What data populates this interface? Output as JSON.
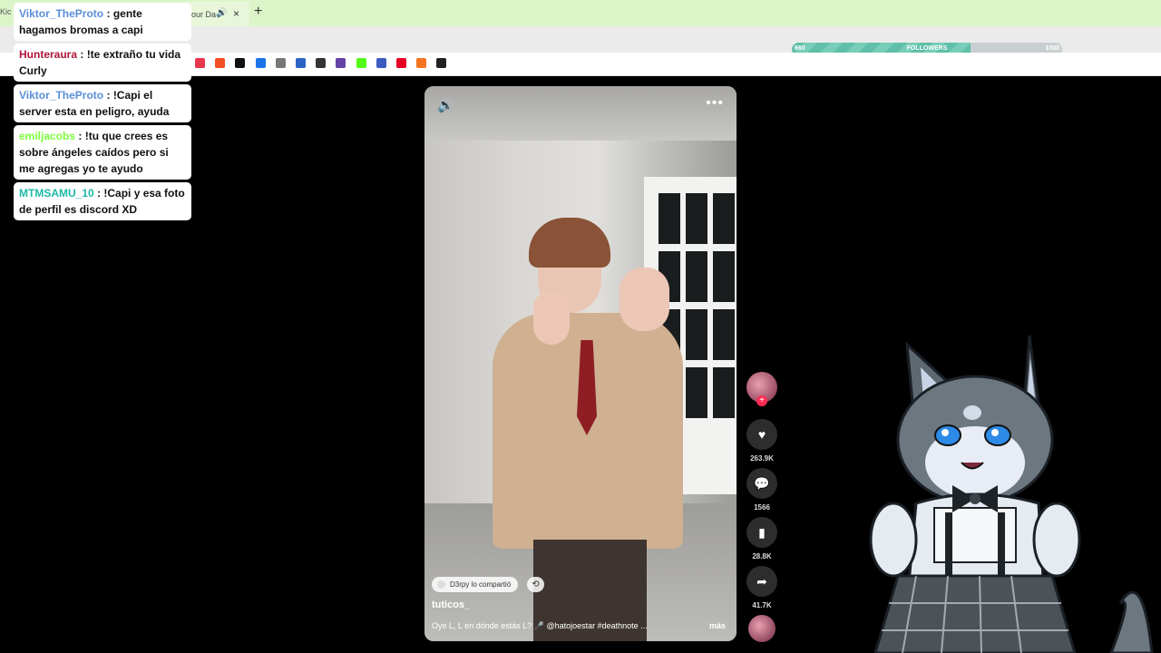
{
  "browser": {
    "tab_left_fragment": "Kic",
    "active_tab_title": "our Da",
    "audio_icon": "speaker-icon",
    "close_label": "×",
    "new_tab_label": "+"
  },
  "followers_bar": {
    "min": "660",
    "label": "FOLLOWERS",
    "max": "1000",
    "fraction": 0.66,
    "fill_color": "#6cc7b0"
  },
  "bookmarks": [
    {
      "name": "pocket-icon",
      "color": "#e8364f"
    },
    {
      "name": "microsoft-icon",
      "color": "#f25022"
    },
    {
      "name": "tiktok-icon",
      "color": "#111111"
    },
    {
      "name": "h-icon",
      "color": "#1a73e8"
    },
    {
      "name": "gear-icon",
      "color": "#777777"
    },
    {
      "name": "pen-icon",
      "color": "#2b63c5"
    },
    {
      "name": "box-icon",
      "color": "#333333"
    },
    {
      "name": "twitch-icon",
      "color": "#6441a5"
    },
    {
      "name": "kick-icon",
      "color": "#53fc18"
    },
    {
      "name": "app-icon",
      "color": "#3b5bbf"
    },
    {
      "name": "pinterest-icon",
      "color": "#e60023"
    },
    {
      "name": "crunchyroll-icon",
      "color": "#f47521"
    },
    {
      "name": "image-icon",
      "color": "#222222"
    }
  ],
  "chat": [
    {
      "user": "Viktor_TheProto",
      "color": "#5a8fd8",
      "text": ": gente hagamos bromas a capi"
    },
    {
      "user": "Hunteraura",
      "color": "#b0153a",
      "text": ": !te extraño tu vida Curly"
    },
    {
      "user": "Viktor_TheProto",
      "color": "#5a8fd8",
      "text": ": !Capi el server esta en peligro, ayuda"
    },
    {
      "user": "emiljacobs",
      "color": "#7cff3c",
      "text": ": !tu que crees es sobre ángeles caídos pero si me agregas yo te ayudo"
    },
    {
      "user": "MTMSAMU_10",
      "color": "#1fb8a6",
      "text": ": !Capi y esa foto de perfil es discord XD"
    }
  ],
  "video": {
    "shared_by": "D3rpy lo compartió",
    "author": "tuticos_",
    "caption": "Oye L, L en dónde estás L? 🎤 @hatojoestar #deathnote ...",
    "more_label": "más",
    "volume_icon": "speaker-icon",
    "menu_icon": "more-icon"
  },
  "actions": {
    "likes": "263.9K",
    "comments": "1566",
    "saves": "28.8K",
    "shares": "41.7K"
  }
}
